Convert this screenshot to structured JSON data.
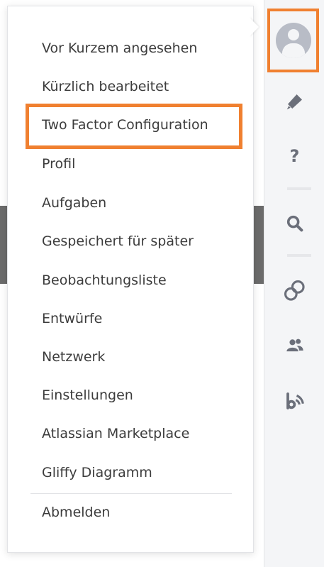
{
  "menu": {
    "items": [
      {
        "label": "Vor Kurzem angesehen"
      },
      {
        "label": "Kürzlich bearbeitet"
      },
      {
        "label": "Two Factor Configuration"
      },
      {
        "label": "Profil"
      },
      {
        "label": "Aufgaben"
      },
      {
        "label": "Gespeichert für später"
      },
      {
        "label": "Beobachtungsliste"
      },
      {
        "label": "Entwürfe"
      },
      {
        "label": "Netzwerk"
      },
      {
        "label": "Einstellungen"
      },
      {
        "label": "Atlassian Marketplace"
      },
      {
        "label": "Gliffy Diagramm"
      }
    ],
    "logout_label": "Abmelden",
    "highlighted_item": "Two Factor Configuration"
  },
  "sidebar": {
    "icons": [
      {
        "name": "user-avatar-icon"
      },
      {
        "name": "bell-icon"
      },
      {
        "name": "help-icon",
        "glyph": "?"
      },
      {
        "name": "search-icon"
      },
      {
        "name": "link-icon"
      },
      {
        "name": "people-icon"
      },
      {
        "name": "feed-icon"
      }
    ]
  },
  "colors": {
    "highlight": "#f08030",
    "menu_text": "#3c3c3c",
    "sidebar_bg": "#f4f5f7",
    "icon_gray": "#6b6f7a"
  }
}
